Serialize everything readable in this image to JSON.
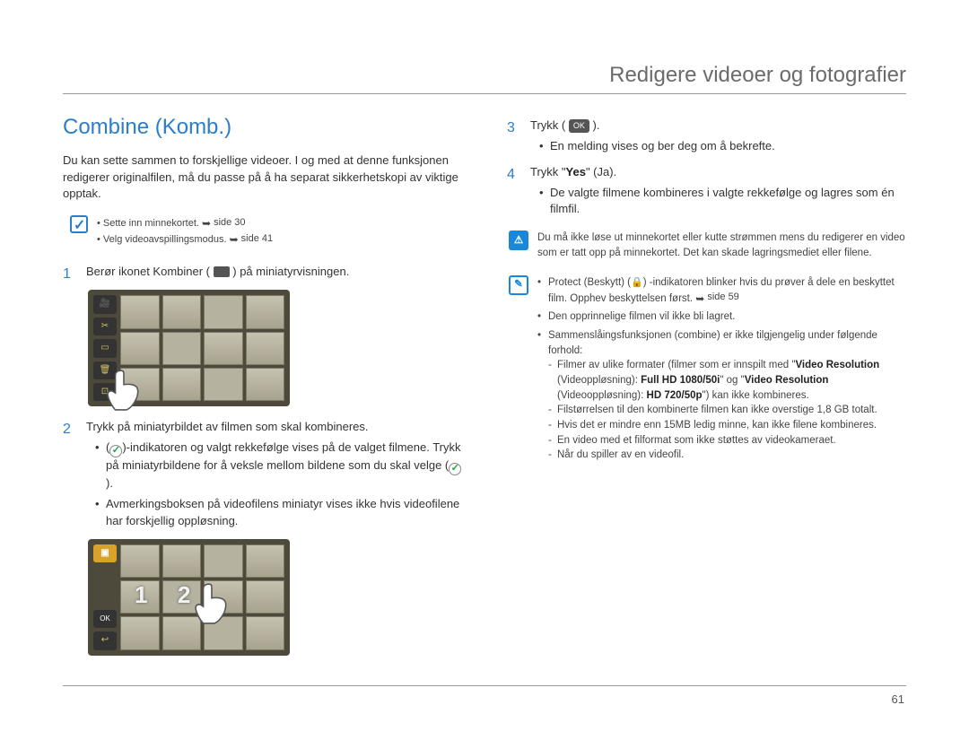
{
  "header": {
    "title": "Redigere videoer og fotografier"
  },
  "section": {
    "title": "Combine (Komb.)"
  },
  "intro": "Du kan sette sammen to forskjellige videoer. I og med at denne funksjonen redigerer originalfilen, må du passe på å ha separat sikkerhetskopi av viktige opptak.",
  "prereq": {
    "item1": "Sette inn minnekortet.",
    "item1_page": "side 30",
    "item2": "Velg videoavspillingsmodus.",
    "item2_page": "side 41"
  },
  "steps": {
    "s1": {
      "num": "1",
      "text_a": "Berør ikonet Kombiner (",
      "text_b": ") på miniatyrvisningen."
    },
    "s2": {
      "num": "2",
      "text": "Trykk på miniatyrbildet av filmen som skal kombineres.",
      "bul1_a": "(",
      "bul1_b": ")-indikatoren og valgt rekkefølge vises på de valget filmene. Trykk på miniatyrbildene for å veksle mellom bildene som du skal velge (",
      "bul1_c": ").",
      "bul2": "Avmerkingsboksen på videofilens miniatyr vises ikke hvis videofilene har forskjellig oppløsning."
    },
    "s3": {
      "num": "3",
      "text_a": "Trykk (",
      "text_b": ").",
      "bul1": "En melding vises og ber deg om å bekrefte."
    },
    "s4": {
      "num": "4",
      "text_a": "Trykk \"",
      "yes": "Yes",
      "text_b": "\" (Ja).",
      "bul1": "De valgte filmene kombineres i valgte rekkefølge og lagres som én filmfil."
    }
  },
  "ok_label": "OK",
  "warn_text": "Du må ikke løse ut minnekortet eller kutte strømmen mens du redigerer en video som er tatt opp på minnekortet. Det kan skade lagringsmediet eller filene.",
  "note": {
    "b1_a": "Protect (Beskytt) (",
    "b1_b": ") -indikatoren blinker hvis du prøver å dele en beskyttet film. Opphev beskyttelsen først.",
    "b1_page": "side 59",
    "b2": "Den opprinnelige filmen vil ikke bli lagret.",
    "b3": "Sammenslåingsfunksjonen (combine) er ikke tilgjengelig under følgende forhold:",
    "s1_a": "Filmer av ulike formater (filmer som er innspilt med \"",
    "s1_b1": "Video Resolution",
    "s1_c": " (Videoppløsning): ",
    "s1_b2": "Full HD  1080/50i",
    "s1_d": "\" og \"",
    "s1_b3": "Video Resolution",
    "s1_e": " (Videooppløsning): ",
    "s1_b4": "HD  720/50p",
    "s1_f": "\") kan ikke kombineres.",
    "s2": "Filstørrelsen til den kombinerte filmen kan ikke overstige 1,8 GB totalt.",
    "s3": "Hvis det er mindre enn 15MB ledig minne, kan ikke filene kombineres.",
    "s4": "En video med et filformat som ikke støttes av videokameraet.",
    "s5": "Når du spiller av en videofil."
  },
  "page_number": "61",
  "thumb_select": {
    "one": "1",
    "two": "2"
  }
}
